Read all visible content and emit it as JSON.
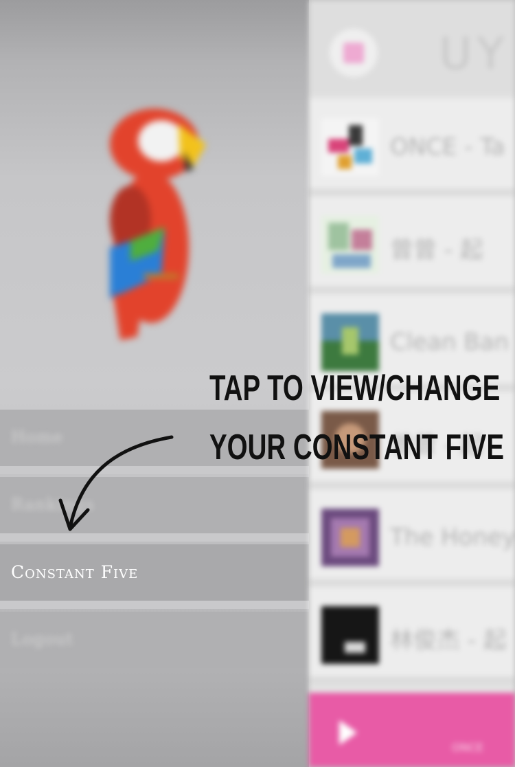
{
  "drawer": {
    "caption": "",
    "menu": [
      {
        "label": "Home"
      },
      {
        "label": "Rankings"
      },
      {
        "label": "Constant Five"
      },
      {
        "label": "Logout"
      }
    ]
  },
  "main": {
    "header_title": "UY",
    "songs": [
      {
        "text": "ONCE - Ta"
      },
      {
        "text": "曾曾 - 起"
      },
      {
        "text": "Clean Ban"
      },
      {
        "text": "曾曾 - 起"
      },
      {
        "text": "The Honey"
      },
      {
        "text": "林俊杰 - 起"
      }
    ],
    "player_text": "ONCE"
  },
  "callout": {
    "line1": "TAP TO VIEW/CHANGE",
    "line2": "YOUR CONSTANT FIVE"
  },
  "colors": {
    "accent": "#e85ba6",
    "drawer_bg": "#c6c6c8",
    "active_item": "#a9a9ab"
  }
}
